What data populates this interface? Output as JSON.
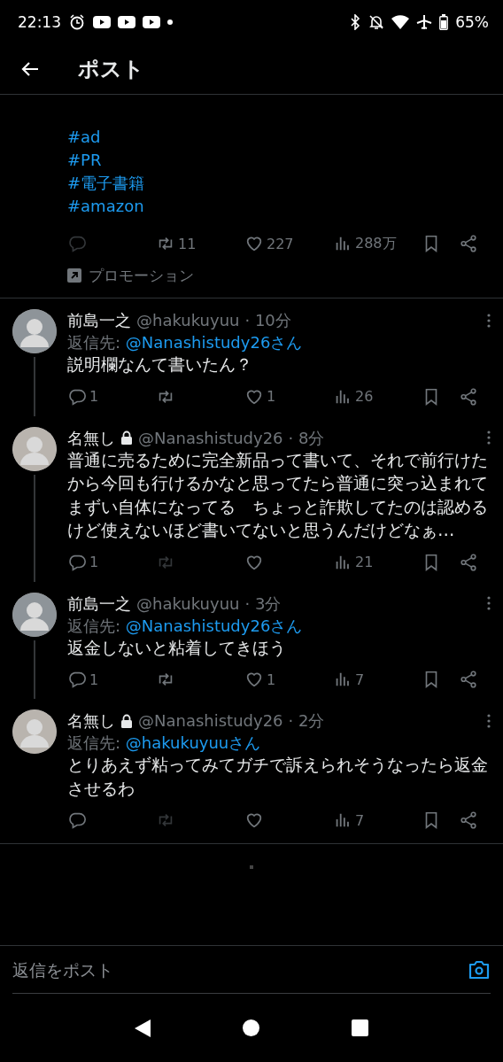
{
  "status_bar": {
    "time": "22:13",
    "battery": "65%"
  },
  "header": {
    "title": "ポスト"
  },
  "ad_post": {
    "hashtags": [
      "#ad",
      "#PR",
      "#電子書籍",
      "#amazon"
    ],
    "reply_disabled": true,
    "retweets": "11",
    "likes": "227",
    "views": "288万",
    "promotion_label": "プロモーション"
  },
  "replies": [
    {
      "author": "前島一之",
      "locked": false,
      "handle": "@hakukuyuu",
      "time": "· 10分",
      "reply_to_label": "返信先:",
      "reply_to": "@Nanashistudy26さん",
      "text": "説明欄なんて書いたん？",
      "replies": "1",
      "retweet_disabled": false,
      "likes": "1",
      "views": "26",
      "thread_continues": true
    },
    {
      "author": "名無し",
      "locked": true,
      "handle": "@Nanashistudy26",
      "time": "· 8分",
      "text": "普通に売るために完全新品って書いて、それで前行けたから今回も行けるかなと思ってたら普通に突っ込まれてまずい自体になってる　ちょっと詐欺してたのは認めるけど使えないほど書いてないと思うんだけどなぁ…",
      "replies": "1",
      "retweet_disabled": true,
      "views": "21",
      "thread_continues": true
    },
    {
      "author": "前島一之",
      "locked": false,
      "handle": "@hakukuyuu",
      "time": "· 3分",
      "reply_to_label": "返信先:",
      "reply_to": "@Nanashistudy26さん",
      "text": "返金しないと粘着してきほう",
      "replies": "1",
      "retweet_disabled": false,
      "likes": "1",
      "views": "7",
      "thread_continues": true
    },
    {
      "author": "名無し",
      "locked": true,
      "handle": "@Nanashistudy26",
      "time": "· 2分",
      "reply_to_label": "返信先:",
      "reply_to": "@hakukuyuuさん",
      "text": "とりあえず粘ってみてガチで訴えられそうなったら返金させるわ",
      "retweet_disabled": true,
      "views": "7",
      "thread_continues": false
    }
  ],
  "composer": {
    "placeholder": "返信をポスト"
  }
}
